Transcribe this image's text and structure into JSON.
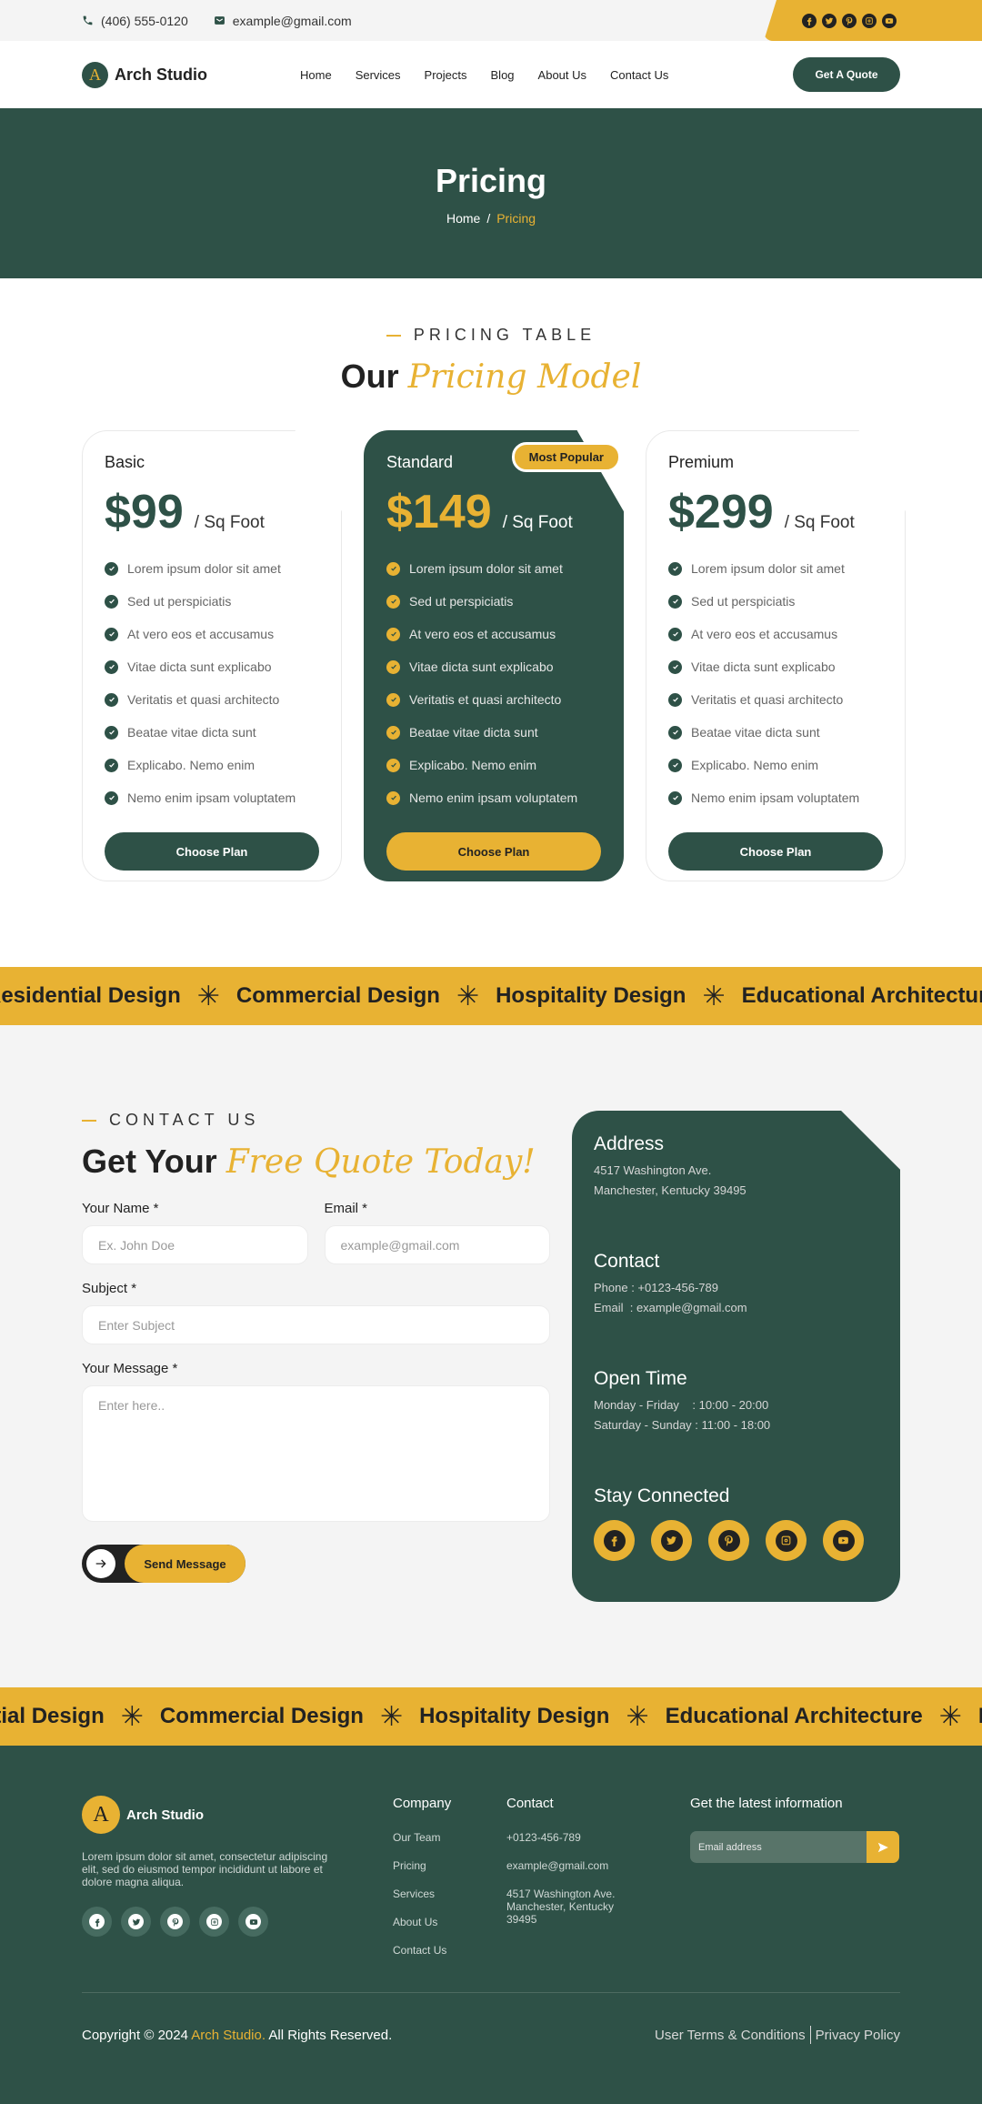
{
  "topbar": {
    "phone": "(406) 555-0120",
    "email": "example@gmail.com",
    "social": [
      "facebook",
      "twitter",
      "pinterest",
      "instagram",
      "youtube"
    ]
  },
  "nav": {
    "brand": "Arch Studio",
    "logo_letter": "A",
    "menu": [
      "Home",
      "Services",
      "Projects",
      "Blog",
      "About Us",
      "Contact Us"
    ],
    "cta": "Get A Quote"
  },
  "hero": {
    "title": "Pricing",
    "breadcrumb": {
      "home": "Home",
      "separator": "/",
      "current": "Pricing"
    }
  },
  "pricing": {
    "eyebrow": "PRICING TABLE",
    "title_plain": "Our",
    "title_script": "Pricing Model",
    "plans": [
      {
        "name": "Basic",
        "price": "$99",
        "unit": "/ Sq Foot",
        "featured": false,
        "features": [
          "Lorem ipsum dolor sit amet",
          "Sed ut perspiciatis",
          "At vero eos et accusamus",
          "Vitae dicta sunt explicabo",
          "Veritatis et quasi architecto",
          "Beatae vitae dicta sunt",
          "Explicabo. Nemo enim",
          "Nemo enim ipsam voluptatem"
        ],
        "button": "Choose Plan"
      },
      {
        "name": "Standard",
        "price": "$149",
        "unit": "/ Sq Foot",
        "featured": true,
        "badge": "Most Popular",
        "features": [
          "Lorem ipsum dolor sit amet",
          "Sed ut perspiciatis",
          "At vero eos et accusamus",
          "Vitae dicta sunt explicabo",
          "Veritatis et quasi architecto",
          "Beatae vitae dicta sunt",
          "Explicabo. Nemo enim",
          "Nemo enim ipsam voluptatem"
        ],
        "button": "Choose Plan"
      },
      {
        "name": "Premium",
        "price": "$299",
        "unit": "/ Sq Foot",
        "featured": false,
        "features": [
          "Lorem ipsum dolor sit amet",
          "Sed ut perspiciatis",
          "At vero eos et accusamus",
          "Vitae dicta sunt explicabo",
          "Veritatis et quasi architecto",
          "Beatae vitae dicta sunt",
          "Explicabo. Nemo enim",
          "Nemo enim ipsam voluptatem"
        ],
        "button": "Choose Plan"
      }
    ]
  },
  "marquee": {
    "items": [
      "Residential Design",
      "Commercial Design",
      "Hospitality Design",
      "Educational Architecture"
    ],
    "separator": "✳"
  },
  "contact": {
    "eyebrow": "CONTACT US",
    "title_plain": "Get Your",
    "title_script": "Free Quote Today!",
    "form": {
      "name_label": "Your Name *",
      "name_placeholder": "Ex. John Doe",
      "name_value": "",
      "email_label": "Email *",
      "email_placeholder": "example@gmail.com",
      "email_value": "",
      "subject_label": "Subject *",
      "subject_placeholder": "Enter Subject",
      "subject_value": "",
      "message_label": "Your Message *",
      "message_placeholder": "Enter here..",
      "message_value": "",
      "submit": "Send Message"
    },
    "info": {
      "address_title": "Address",
      "address_line1": "4517 Washington Ave.",
      "address_line2": "Manchester, Kentucky 39495",
      "contact_title": "Contact",
      "phone": "Phone : +0123-456-789",
      "email": "Email  : example@gmail.com",
      "hours_title": "Open Time",
      "hours_weekday": "Monday - Friday    : 10:00 - 20:00",
      "hours_weekend": "Saturday - Sunday : 11:00 - 18:00",
      "social_title": "Stay Connected",
      "social": [
        "facebook",
        "twitter",
        "pinterest",
        "instagram",
        "youtube"
      ]
    }
  },
  "marquee2": {
    "items": [
      "Residential Design",
      "Commercial Design",
      "Hospitality Design",
      "Educational Architecture"
    ],
    "separator": "✳"
  },
  "footer": {
    "brand": "Arch Studio",
    "logo_letter": "A",
    "description": "Lorem ipsum dolor sit amet, consectetur adipiscing elit, sed do eiusmod tempor incididunt ut labore et dolore magna aliqua.",
    "social": [
      "facebook",
      "twitter",
      "pinterest",
      "instagram",
      "youtube"
    ],
    "company_title": "Company",
    "company_links": [
      "Our Team",
      "Pricing",
      "Services",
      "About Us",
      "Contact Us"
    ],
    "contact_title": "Contact",
    "contact_phone": "+0123-456-789",
    "contact_email": "example@gmail.com",
    "contact_address": "4517 Washington Ave. Manchester, Kentucky 39495",
    "newsletter_title": "Get the latest information",
    "newsletter_placeholder": "Email address",
    "copyright_prefix": "Copyright © 2024",
    "copyright_brand": "Arch Studio.",
    "copyright_suffix": "All Rights Reserved.",
    "terms": "User Terms & Conditions",
    "privacy": "Privacy Policy"
  },
  "colors": {
    "primary": "#2e5147",
    "accent": "#e8b233",
    "dark": "#222222",
    "light_bg": "#f4f4f4"
  }
}
